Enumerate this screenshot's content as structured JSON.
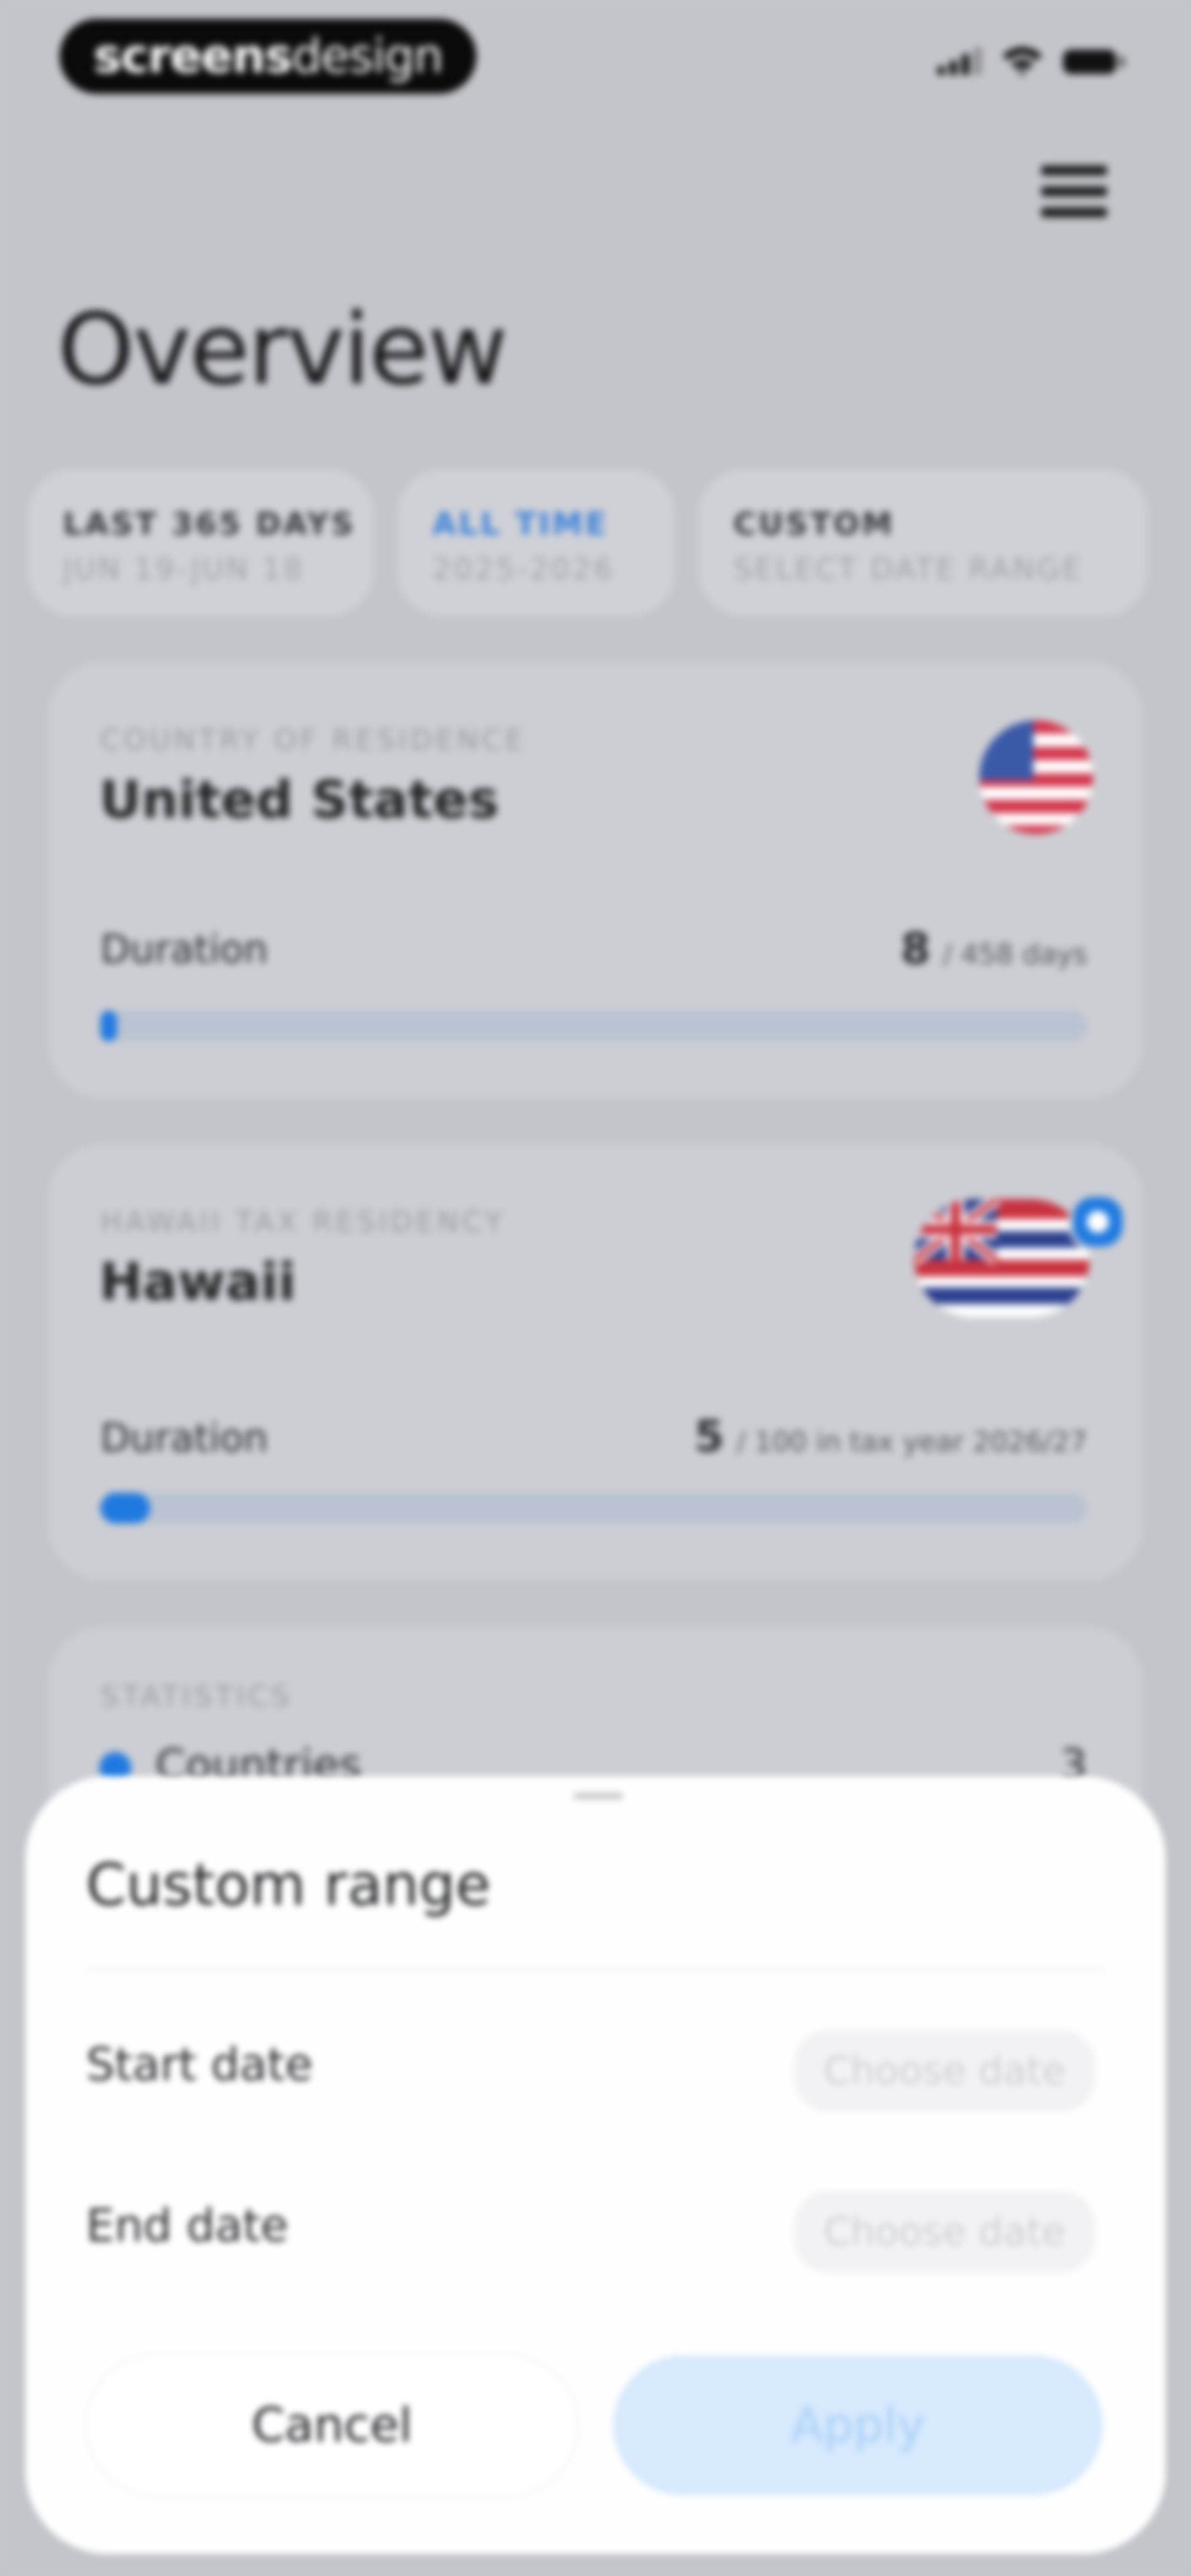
{
  "status_bar": {
    "brand_bold": "screens",
    "brand_light": "design"
  },
  "header": {
    "title": "Overview"
  },
  "filters": [
    {
      "label": "LAST 365 DAYS",
      "sub": "JUN 19-JUN 18",
      "active": false
    },
    {
      "label": "ALL TIME",
      "sub": "2025-2026",
      "active": true
    },
    {
      "label": "CUSTOM",
      "sub": "SELECT DATE RANGE",
      "active": false
    }
  ],
  "cards": [
    {
      "kicker": "COUNTRY OF RESIDENCE",
      "name": "United States",
      "duration_label": "Duration",
      "value": "8",
      "value_suffix": "/ 458 days",
      "progress": 0.017
    },
    {
      "kicker": "HAWAII TAX RESIDENCY",
      "name": "Hawaii",
      "duration_label": "Duration",
      "value": "5",
      "value_suffix": "/ 100 in tax year 2026/27",
      "progress": 0.05
    },
    {
      "kicker": "STATISTICS",
      "row_label": "Countries",
      "row_value": "3"
    }
  ],
  "sheet": {
    "title": "Custom range",
    "start_label": "Start date",
    "start_placeholder": "Choose date",
    "end_label": "End date",
    "end_placeholder": "Choose date",
    "cancel": "Cancel",
    "apply": "Apply"
  },
  "colors": {
    "accent": "#1f7ae0",
    "apply_bg": "#d6e9fd",
    "backdrop": "#c4c5ca"
  }
}
